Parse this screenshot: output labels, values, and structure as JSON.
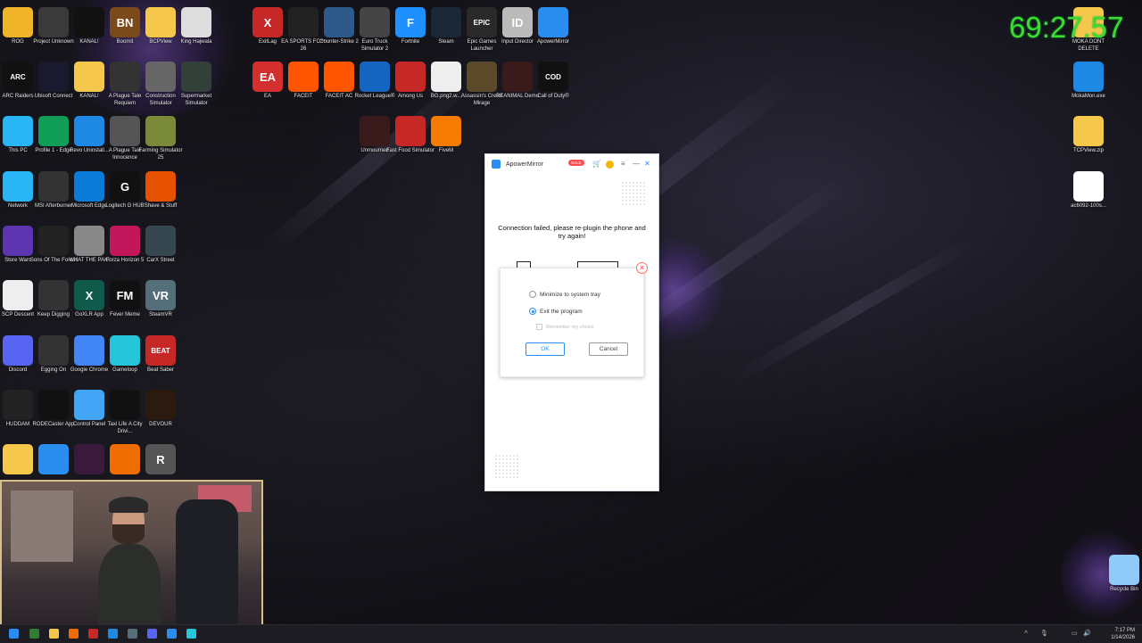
{
  "overlay": {
    "timer": "69:27.57"
  },
  "desktop_icons": [
    {
      "label": "ROG",
      "color": "#f0b429",
      "glyph": ""
    },
    {
      "label": "Project Unknown",
      "color": "#3a3a3a",
      "glyph": ""
    },
    {
      "label": "KANAL!",
      "color": "#111111",
      "glyph": ""
    },
    {
      "label": "Boomit",
      "color": "#7a4a1a",
      "glyph": "BN"
    },
    {
      "label": "BCPView",
      "color": "#f5c84c",
      "glyph": ""
    },
    {
      "label": "King Hajwala",
      "color": "#dddddd",
      "glyph": ""
    },
    {
      "label": "ExitLag",
      "color": "#c62828",
      "glyph": "X"
    },
    {
      "label": "EA SPORTS FC™ 26",
      "color": "#222222",
      "glyph": ""
    },
    {
      "label": "Counter-Strike 2",
      "color": "#2d5a8a",
      "glyph": ""
    },
    {
      "label": "Euro Truck Simulator 2",
      "color": "#444444",
      "glyph": ""
    },
    {
      "label": "Fortnite",
      "color": "#1e90ff",
      "glyph": "F"
    },
    {
      "label": "Steam",
      "color": "#1b2838",
      "glyph": ""
    },
    {
      "label": "Epic Games Launcher",
      "color": "#2a2a2a",
      "glyph": "EPIC"
    },
    {
      "label": "Input Director",
      "color": "#bbbbbb",
      "glyph": "ID"
    },
    {
      "label": "ApowerMirror",
      "color": "#2a8df0",
      "glyph": ""
    },
    {
      "label": "MOKA DONT DELETE",
      "color": "#f5c84c",
      "glyph": ""
    },
    {
      "label": "ARC Raiders",
      "color": "#111111",
      "glyph": "ARC"
    },
    {
      "label": "Ubisoft Connect",
      "color": "#1a1a2e",
      "glyph": ""
    },
    {
      "label": "KANAL!",
      "color": "#f5c84c",
      "glyph": ""
    },
    {
      "label": "A Plague Tale Requiem",
      "color": "#333333",
      "glyph": ""
    },
    {
      "label": "Construction Simulator",
      "color": "#666666",
      "glyph": ""
    },
    {
      "label": "Supermarket Simulator",
      "color": "#33403a",
      "glyph": ""
    },
    {
      "label": "EA",
      "color": "#d32f2f",
      "glyph": "EA"
    },
    {
      "label": "FACEIT",
      "color": "#ff5500",
      "glyph": ""
    },
    {
      "label": "FACEIT AC",
      "color": "#ff5500",
      "glyph": ""
    },
    {
      "label": "Rocket League®",
      "color": "#1565c0",
      "glyph": ""
    },
    {
      "label": "Among Us",
      "color": "#c62828",
      "glyph": ""
    },
    {
      "label": "BG.png2.w...",
      "color": "#eeeeee",
      "glyph": ""
    },
    {
      "label": "Assassin's Creed Mirage",
      "color": "#5a4a2a",
      "glyph": ""
    },
    {
      "label": "REANIMAL Demo",
      "color": "#3a1a1a",
      "glyph": ""
    },
    {
      "label": "Call of Duty®",
      "color": "#111111",
      "glyph": "COD"
    },
    {
      "label": "MokaMon.exe",
      "color": "#1e88e5",
      "glyph": ""
    },
    {
      "label": "This PC",
      "color": "#29b6f6",
      "glyph": ""
    },
    {
      "label": "Profile 1 - Edge",
      "color": "#0f9d58",
      "glyph": ""
    },
    {
      "label": "Revo Uninstall...",
      "color": "#1e88e5",
      "glyph": ""
    },
    {
      "label": "A Plague Tale Innocence",
      "color": "#555555",
      "glyph": ""
    },
    {
      "label": "Farming Simulator 25",
      "color": "#7a8a3a",
      "glyph": ""
    },
    {
      "label": "Unmourned",
      "color": "#3a1a1a",
      "glyph": ""
    },
    {
      "label": "Fast Food Simulator",
      "color": "#c62828",
      "glyph": ""
    },
    {
      "label": "FiveM",
      "color": "#f57c00",
      "glyph": ""
    },
    {
      "label": "TCPView.zip",
      "color": "#f5c84c",
      "glyph": ""
    },
    {
      "label": "Network",
      "color": "#29b6f6",
      "glyph": ""
    },
    {
      "label": "MSI Afterburner",
      "color": "#333333",
      "glyph": ""
    },
    {
      "label": "Microsoft Edge",
      "color": "#0b7bd8",
      "glyph": ""
    },
    {
      "label": "Logitech G HUB",
      "color": "#111111",
      "glyph": "G"
    },
    {
      "label": "Shave & Stuff",
      "color": "#e65100",
      "glyph": ""
    },
    {
      "label": "ac6092-100s...",
      "color": "#ffffff",
      "glyph": ""
    },
    {
      "label": "Store Wars",
      "color": "#5e35b1",
      "glyph": ""
    },
    {
      "label": "Sons Of The Forest",
      "color": "#222222",
      "glyph": ""
    },
    {
      "label": "WHAT THE PAK!",
      "color": "#888888",
      "glyph": ""
    },
    {
      "label": "Forza Horizon 5",
      "color": "#c2185b",
      "glyph": ""
    },
    {
      "label": "CarX Street",
      "color": "#37474f",
      "glyph": ""
    },
    {
      "label": "SCP Descent",
      "color": "#eeeeee",
      "glyph": ""
    },
    {
      "label": "Keep Digging",
      "color": "#333333",
      "glyph": ""
    },
    {
      "label": "GoXLR App",
      "color": "#0f5a4a",
      "glyph": "X"
    },
    {
      "label": "Fever Meme",
      "color": "#111111",
      "glyph": "FM"
    },
    {
      "label": "SteamVR",
      "color": "#546e7a",
      "glyph": "VR"
    },
    {
      "label": "Discord",
      "color": "#5865f2",
      "glyph": ""
    },
    {
      "label": "Egging On",
      "color": "#333333",
      "glyph": ""
    },
    {
      "label": "Google Chrome",
      "color": "#4285f4",
      "glyph": ""
    },
    {
      "label": "Gameloop",
      "color": "#26c6da",
      "glyph": ""
    },
    {
      "label": "Beat Saber",
      "color": "#c62828",
      "glyph": "BEAT"
    },
    {
      "label": "HUDDAM",
      "color": "#222222",
      "glyph": ""
    },
    {
      "label": "RODECaster App",
      "color": "#111111",
      "glyph": ""
    },
    {
      "label": "Control Panel",
      "color": "#42a5f5",
      "glyph": ""
    },
    {
      "label": "Taxi Life A City Drivi...",
      "color": "#111111",
      "glyph": ""
    },
    {
      "label": "DEVOUR",
      "color": "#2a1a10",
      "glyph": ""
    },
    {
      "label": "",
      "color": "#f5c84c",
      "glyph": ""
    },
    {
      "label": "",
      "color": "#2a8df0",
      "glyph": ""
    },
    {
      "label": "",
      "color": "#3a1a3a",
      "glyph": ""
    },
    {
      "label": "",
      "color": "#ef6c00",
      "glyph": ""
    },
    {
      "label": "",
      "color": "#555555",
      "glyph": "R"
    },
    {
      "label": "Recycle Bin",
      "color": "#90caf9",
      "glyph": ""
    }
  ],
  "app": {
    "title": "ApowerMirror",
    "sale_badge": "SALE",
    "message": "Connection failed, please re-plugin the phone and try again!",
    "dialog": {
      "option_minimize": "Minimize to system tray",
      "option_exit": "Exit the program",
      "remember": "Remember my choice",
      "ok": "OK",
      "cancel": "Cancel"
    }
  },
  "taskbar": {
    "time": "7:17 PM",
    "date": "1/14/2026"
  }
}
